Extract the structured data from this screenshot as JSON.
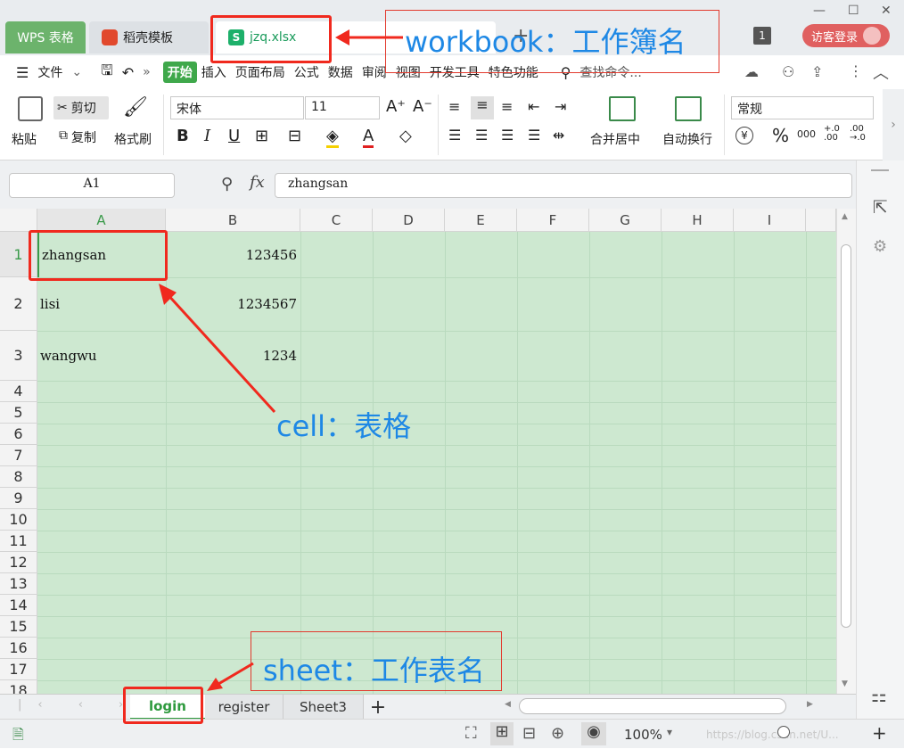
{
  "window": {
    "app_tab": "WPS 表格",
    "template_tab": "稻壳模板",
    "file_tab": "jzq.xlsx",
    "file_icon": "S",
    "tab_count": "1",
    "login_button": "访客登录"
  },
  "menu": {
    "file": "文件",
    "items": [
      "开始",
      "插入",
      "页面布局",
      "公式",
      "数据",
      "审阅",
      "视图",
      "开发工具",
      "特色功能"
    ],
    "search": "查找命令..."
  },
  "ribbon": {
    "paste": "粘贴",
    "cut": "剪切",
    "copy": "复制",
    "format_painter": "格式刷",
    "font": "宋体",
    "font_size": "11",
    "bold": "B",
    "italic": "I",
    "underline": "U",
    "merge_center": "合并居中",
    "wrap_text": "自动换行",
    "number_format": "常规",
    "percent": "%",
    "thousands": "000",
    "inc_decimal": "+.0 .00",
    "dec_decimal": ".00 →.0",
    "currency": "¥"
  },
  "formula": {
    "name_box": "A1",
    "fx": "fx",
    "value": "zhangsan"
  },
  "grid": {
    "columns": [
      "A",
      "B",
      "C",
      "D",
      "E",
      "F",
      "G",
      "H",
      "I"
    ],
    "rows": [
      "1",
      "2",
      "3",
      "4",
      "5",
      "6",
      "7",
      "8",
      "9",
      "10",
      "11",
      "12",
      "13",
      "14",
      "15",
      "16",
      "17",
      "18"
    ],
    "data": [
      {
        "a": "zhangsan",
        "b": "123456"
      },
      {
        "a": "lisi",
        "b": "1234567"
      },
      {
        "a": "wangwu",
        "b": "1234"
      }
    ]
  },
  "sheets": [
    "login",
    "register",
    "Sheet3"
  ],
  "status": {
    "zoom": "100%",
    "watermark": "https://blog.csdn.net/U..."
  },
  "annotations": {
    "workbook": "workbook：工作簿名",
    "cell": "cell：表格",
    "sheet": "sheet：工作表名"
  },
  "colors": {
    "accent": "#3fa84b",
    "annotation": "#1e88e5",
    "highlight": "#f0291e",
    "cell_bg": "#cde8d0"
  }
}
